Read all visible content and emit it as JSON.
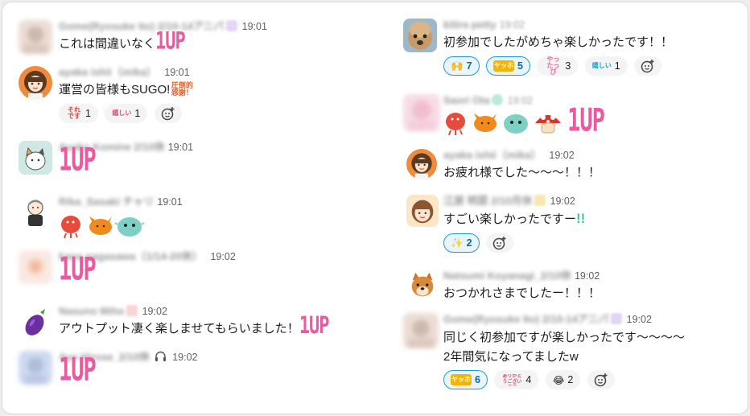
{
  "messages": [
    {
      "name": "Gome(Ryosuke Ito) 2/10-14アニバ",
      "time": "19:01",
      "text": "これは間違いなく",
      "oneup": "1UP"
    },
    {
      "name": "ayaka ishii（mika）",
      "time": "19:01",
      "text": "運営の皆様もSUGO!",
      "stamp": "圧倒的感謝！",
      "reactions": [
        {
          "emoji": "それです",
          "count": "1"
        },
        {
          "emoji": "嬉しい",
          "count": "1"
        }
      ]
    },
    {
      "name": "Ayako Komine 2/10休",
      "time": "19:01",
      "oneup": "1UP"
    },
    {
      "name": "Rika_Sasaki チャリ",
      "time": "19:01"
    },
    {
      "name": "kana.nagasawa（1/14-20休）",
      "time": "19:02",
      "oneup": "1UP"
    },
    {
      "name": "Nasuno Miho",
      "time": "19:02",
      "text": "アウトプット凄く楽しませてもらいました！",
      "oneup": "1UP"
    },
    {
      "name": "Aya Hirose_2/10休",
      "time": "19:02",
      "oneup": "1UP"
    },
    {
      "name": "kitira petty",
      "time": "19:02",
      "text": "初参加でしたがめちゃ楽しかったです！！",
      "reactions": [
        {
          "emoji": "🙌",
          "count": "7"
        },
        {
          "emoji": "ヤッホ",
          "count": "5"
        },
        {
          "emoji": "やったっぴ",
          "count": "3"
        },
        {
          "emoji": "嬉しい",
          "count": "1"
        }
      ]
    },
    {
      "name": "Saori Ota",
      "time": "19:02",
      "oneup": "1UP"
    },
    {
      "name": "ayaka ishii（mika）",
      "time": "19:02",
      "text": "お疲れ様でした〜〜〜！！！"
    },
    {
      "name": "江原 明菜 2/10月休",
      "time": "19:02",
      "text": "すごい楽しかったですー",
      "extra": "!!",
      "reactions": [
        {
          "emoji": "✨",
          "count": "2"
        }
      ]
    },
    {
      "name": "Natsumi Koyanagi_2/10休",
      "time": "19:02",
      "text": "おつかれさまでしたー！！！"
    },
    {
      "name": "Gome(Ryosuke Ito) 2/10-14アニバ",
      "time": "19:02",
      "text": "同じく初参加ですが楽しかったです〜〜〜〜",
      "text2": "2年間気になってましたw",
      "reactions": [
        {
          "emoji": "ヤッホ",
          "count": "6"
        },
        {
          "emoji": "ありがとうございます",
          "count": "4"
        },
        {
          "emoji": "😂",
          "count": "2"
        }
      ]
    }
  ],
  "colors": {
    "accent": "#1264a3",
    "oneup": "#ea5aa0",
    "reaction_bg": "#f4f4f4"
  }
}
